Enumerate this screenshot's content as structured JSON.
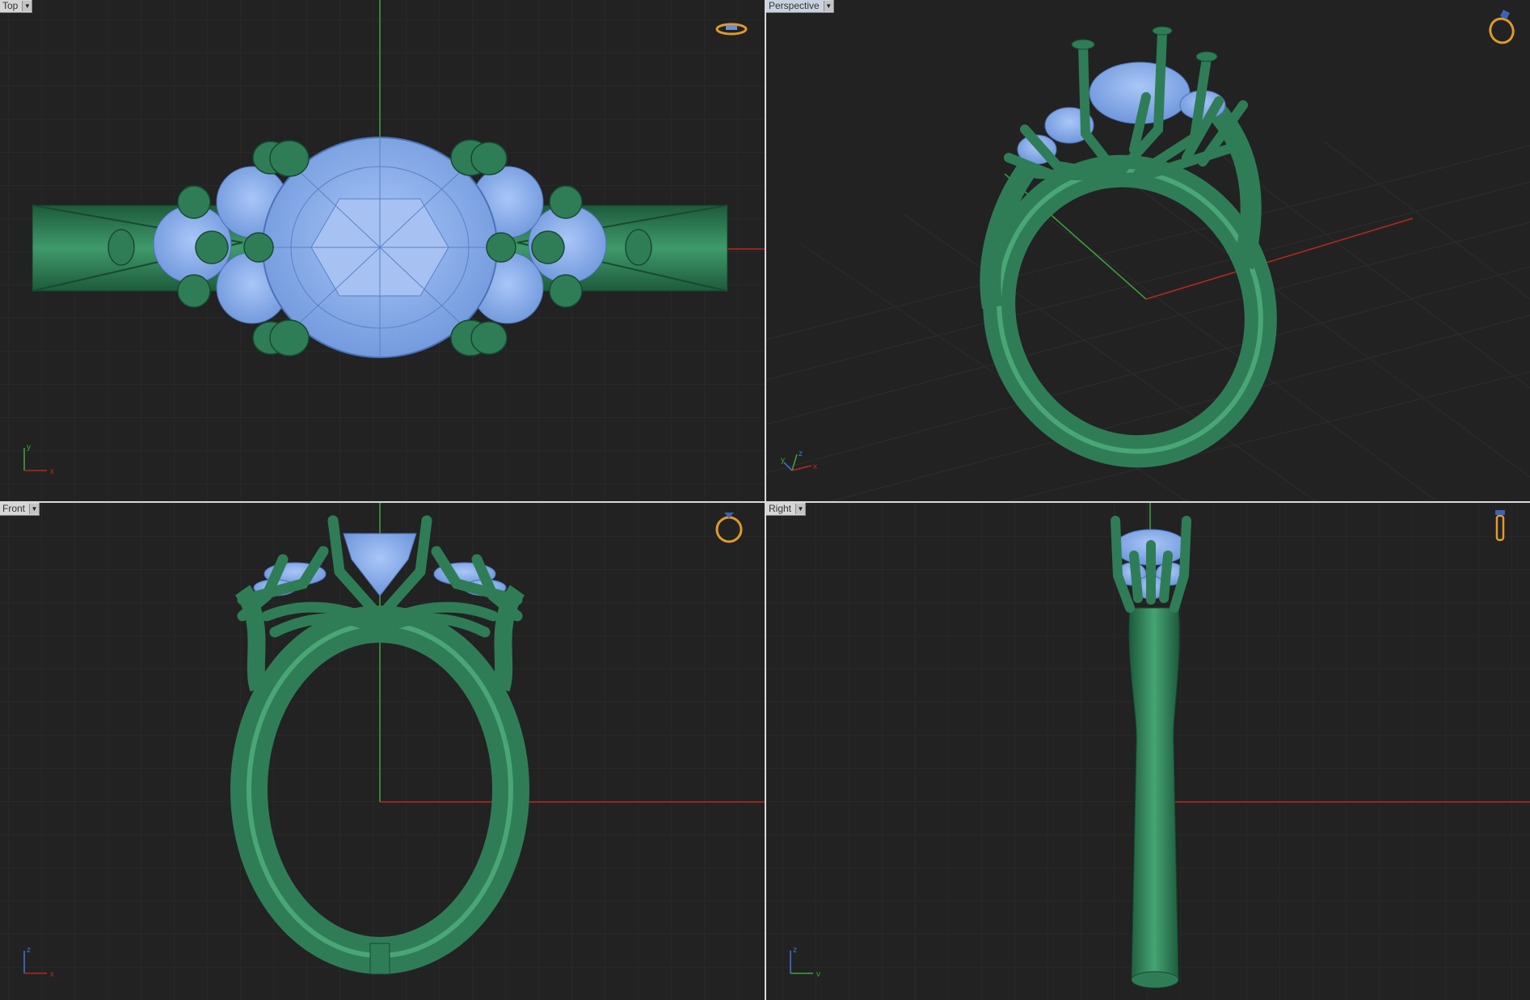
{
  "viewports": {
    "top": {
      "label": "Top",
      "axis_vertical": "y",
      "axis_horizontal": "x"
    },
    "perspective": {
      "label": "Perspective",
      "axis_vertical": "z",
      "axis_horizontal": "x",
      "axis_third": "y"
    },
    "front": {
      "label": "Front",
      "axis_vertical": "z",
      "axis_horizontal": "x"
    },
    "right": {
      "label": "Right",
      "axis_vertical": "z",
      "axis_horizontal": "y"
    }
  },
  "icons": {
    "viewport_menu": "chevron-down-icon",
    "navigation_widget": "ring-nav-icon",
    "axis_indicator": "axis-icon"
  },
  "colors": {
    "background": "#222222",
    "grid": "#2e2e2e",
    "metal": "#2f7d56",
    "gem": "#8fb4f2",
    "x_axis": "#b8281f",
    "y_axis": "#3fa53f",
    "nav_widget": "#e09a2b"
  }
}
